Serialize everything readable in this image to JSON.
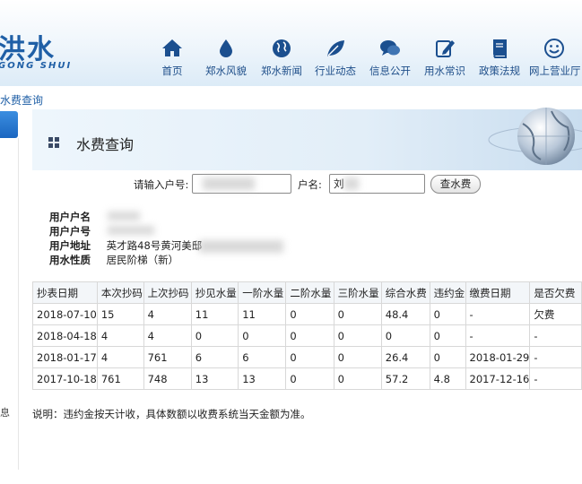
{
  "header": {
    "logo_main": "洪水",
    "logo_sub": "GONG SHUI",
    "nav": [
      {
        "label": "首页",
        "icon": "home-icon"
      },
      {
        "label": "郑水风貌",
        "icon": "water-drop-icon"
      },
      {
        "label": "郑水新闻",
        "icon": "globe-icon"
      },
      {
        "label": "行业动态",
        "icon": "leaf-icon"
      },
      {
        "label": "信息公开",
        "icon": "chat-bubbles-icon"
      },
      {
        "label": "用水常识",
        "icon": "edit-note-icon"
      },
      {
        "label": "政策法规",
        "icon": "book-icon"
      },
      {
        "label": "网上营业厅",
        "icon": "smiley-icon"
      }
    ]
  },
  "breadcrumb": "水费查询",
  "sidebar": {
    "edge_char": "息"
  },
  "main": {
    "title": "水费查询",
    "form": {
      "account_label": "请输入户号:",
      "account_value": "",
      "name_label": "户名:",
      "name_value": "刘",
      "submit_label": "查水费"
    },
    "user_info": [
      {
        "key": "用户户名",
        "value": ""
      },
      {
        "key": "用户户号",
        "value": ""
      },
      {
        "key": "用户地址",
        "value": "英才路48号黄河美邸"
      },
      {
        "key": "用水性质",
        "value": "居民阶梯（新）"
      }
    ],
    "table": {
      "headers": [
        "抄表日期",
        "本次抄码",
        "上次抄码",
        "抄见水量",
        "一阶水量",
        "二阶水量",
        "三阶水量",
        "综合水费",
        "违约金",
        "缴费日期",
        "是否欠费"
      ],
      "rows": [
        [
          "2018-07-10",
          "15",
          "4",
          "11",
          "11",
          "0",
          "0",
          "48.4",
          "0",
          "-",
          "欠费"
        ],
        [
          "2018-04-18",
          "4",
          "4",
          "0",
          "0",
          "0",
          "0",
          "0",
          "0",
          "-",
          "-"
        ],
        [
          "2018-01-17",
          "4",
          "761",
          "6",
          "6",
          "0",
          "0",
          "26.4",
          "0",
          "2018-01-29",
          "-"
        ],
        [
          "2017-10-18",
          "761",
          "748",
          "13",
          "13",
          "0",
          "0",
          "57.2",
          "4.8",
          "2017-12-16",
          "-"
        ]
      ]
    },
    "note": "说明：违约金按天计收，具体数额以收费系统当天金额为准。"
  },
  "colors": {
    "brand": "#1f5fa6",
    "accent_tab": "#1a66c0",
    "nav_text": "#1f4f8a"
  }
}
